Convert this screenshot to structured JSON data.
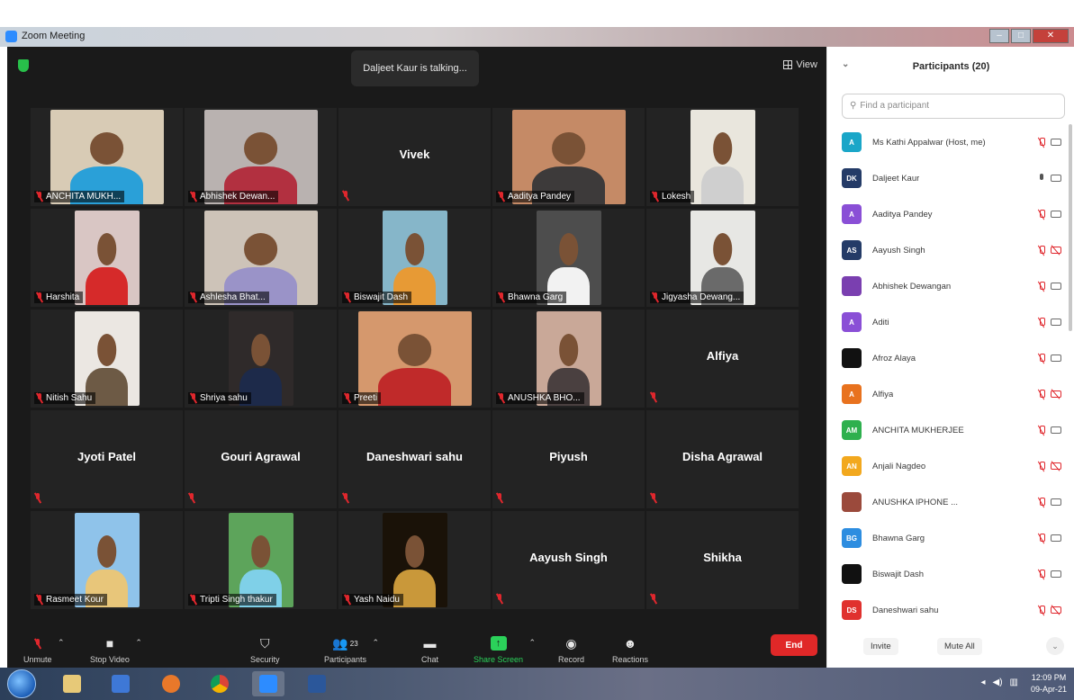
{
  "window": {
    "title": "Zoom Meeting"
  },
  "header": {
    "talking": "Daljeet Kaur is talking...",
    "view_label": "View"
  },
  "tiles": [
    {
      "name": "ANCHITA MUKH...",
      "video": true,
      "bg": "#d8cbb5",
      "shirt": "#2aa0d8",
      "narrow": false
    },
    {
      "name": "Abhishek Dewan...",
      "video": true,
      "bg": "#b9b2b0",
      "shirt": "#b23040",
      "narrow": false
    },
    {
      "name": "Vivek",
      "video": false
    },
    {
      "name": "Aaditya Pandey",
      "video": true,
      "bg": "#c58a66",
      "shirt": "#3d3a3a",
      "narrow": false
    },
    {
      "name": "Lokesh",
      "video": true,
      "bg": "#e9e6dd",
      "shirt": "#cfcfcf",
      "narrow": true
    },
    {
      "name": "Harshita",
      "video": true,
      "bg": "#d9c6c4",
      "shirt": "#d62a2a",
      "narrow": true
    },
    {
      "name": "Ashlesha Bhat...",
      "video": true,
      "bg": "#cdc3b8",
      "shirt": "#9a93c8",
      "narrow": false
    },
    {
      "name": "Biswajit Dash",
      "video": true,
      "bg": "#86b6c9",
      "shirt": "#e79a35",
      "narrow": true
    },
    {
      "name": "Bhawna Garg",
      "video": true,
      "bg": "#4d4d4d",
      "shirt": "#f2f2f2",
      "narrow": true
    },
    {
      "name": "Jigyasha Dewang...",
      "video": true,
      "bg": "#e7e7e4",
      "shirt": "#6a6a6a",
      "narrow": true
    },
    {
      "name": "Nitish Sahu",
      "video": true,
      "bg": "#ebe7e2",
      "shirt": "#6d5a45",
      "narrow": true
    },
    {
      "name": "Shriya sahu",
      "video": true,
      "bg": "#2f2a2a",
      "shirt": "#1d2a4a",
      "narrow": true
    },
    {
      "name": "Preeti",
      "video": true,
      "bg": "#d5986d",
      "shirt": "#c02a2a",
      "narrow": false
    },
    {
      "name": "ANUSHKA BHO...",
      "video": true,
      "bg": "#c9a898",
      "shirt": "#4a4040",
      "narrow": true
    },
    {
      "name": "Alfiya",
      "video": false
    },
    {
      "name": "Jyoti Patel",
      "video": false
    },
    {
      "name": "Gouri Agrawal",
      "video": false
    },
    {
      "name": "Daneshwari sahu",
      "video": false
    },
    {
      "name": "Piyush",
      "video": false
    },
    {
      "name": "Disha Agrawal",
      "video": false
    },
    {
      "name": "Rasmeet Kour",
      "video": true,
      "bg": "#8fc3ea",
      "shirt": "#e8c67a",
      "narrow": true
    },
    {
      "name": "Tripti Singh thakur",
      "video": true,
      "bg": "#5da45b",
      "shirt": "#7fd0e8",
      "narrow": true
    },
    {
      "name": "Yash Naidu",
      "video": true,
      "bg": "#1a1208",
      "shirt": "#c9983a",
      "narrow": true
    },
    {
      "name": "Aayush Singh",
      "video": false
    },
    {
      "name": "Shikha",
      "video": false
    }
  ],
  "toolbar": {
    "unmute": "Unmute",
    "stop_video": "Stop Video",
    "security": "Security",
    "participants": "Participants",
    "participants_count": "23",
    "chat": "Chat",
    "share_screen": "Share Screen",
    "record": "Record",
    "reactions": "Reactions",
    "end": "End"
  },
  "panel": {
    "title": "Participants (20)",
    "search_placeholder": "Find a participant",
    "invite": "Invite",
    "mute_all": "Mute All",
    "participants": [
      {
        "initials": "A",
        "color": "#1aa6c8",
        "name": "Ms Kathi Appalwar (Host, me)",
        "mic": "off",
        "cam": "on"
      },
      {
        "initials": "DK",
        "color": "#243b67",
        "name": "Daljeet Kaur",
        "mic": "on",
        "cam": "on"
      },
      {
        "initials": "A",
        "color": "#8a4fd6",
        "name": "Aaditya Pandey",
        "mic": "off",
        "cam": "on"
      },
      {
        "initials": "AS",
        "color": "#243b67",
        "name": "Aayush Singh",
        "mic": "off",
        "cam": "off"
      },
      {
        "initials": "",
        "color": "#7a3fb0",
        "name": "Abhishek Dewangan",
        "mic": "off",
        "cam": "on"
      },
      {
        "initials": "A",
        "color": "#8a4fd6",
        "name": "Aditi",
        "mic": "off",
        "cam": "on"
      },
      {
        "initials": "",
        "color": "#111111",
        "name": "Afroz Alaya",
        "mic": "off",
        "cam": "on"
      },
      {
        "initials": "A",
        "color": "#e8721e",
        "name": "Alfiya",
        "mic": "off",
        "cam": "off"
      },
      {
        "initials": "AM",
        "color": "#2eb04e",
        "name": "ANCHITA MUKHERJEE",
        "mic": "off",
        "cam": "on"
      },
      {
        "initials": "AN",
        "color": "#f2a81e",
        "name": "Anjali Nagdeo",
        "mic": "off",
        "cam": "off"
      },
      {
        "initials": "",
        "color": "#9b4a3c",
        "name": "ANUSHKA IPHONE ...",
        "mic": "off",
        "cam": "on"
      },
      {
        "initials": "BG",
        "color": "#2d8de0",
        "name": "Bhawna Garg",
        "mic": "off",
        "cam": "on"
      },
      {
        "initials": "",
        "color": "#111111",
        "name": "Biswajit Dash",
        "mic": "off",
        "cam": "on"
      },
      {
        "initials": "DS",
        "color": "#e0312e",
        "name": "Daneshwari sahu",
        "mic": "off",
        "cam": "off"
      }
    ]
  },
  "taskbar": {
    "time": "12:09 PM",
    "date": "09-Apr-21"
  }
}
